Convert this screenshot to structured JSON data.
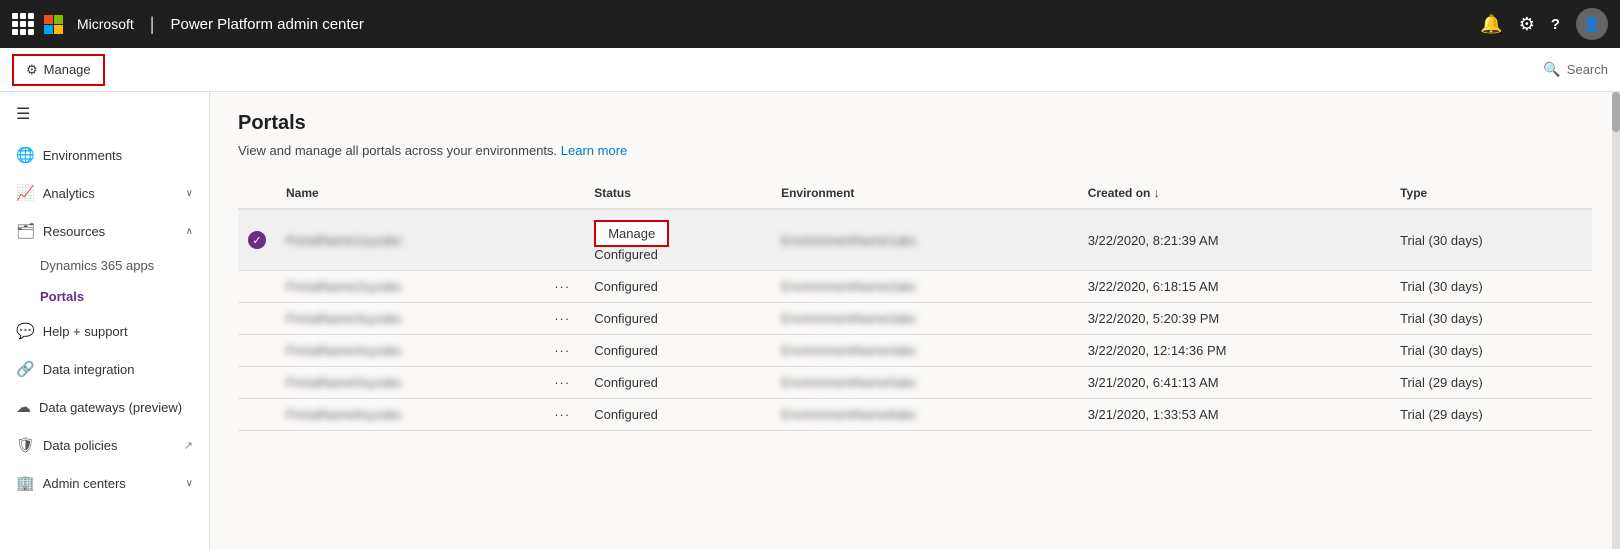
{
  "topNav": {
    "appName": "Power Platform admin center",
    "icons": {
      "bell": "🔔",
      "settings": "⚙",
      "help": "?",
      "waffle": "waffle"
    }
  },
  "secondaryNav": {
    "manageBtn": "Manage",
    "manageBtnIcon": "⚙",
    "searchPlaceholder": "Search"
  },
  "sidebar": {
    "hamburgerIcon": "☰",
    "items": [
      {
        "id": "environments",
        "label": "Environments",
        "icon": "🌐",
        "hasChevron": false,
        "active": false
      },
      {
        "id": "analytics",
        "label": "Analytics",
        "icon": "📈",
        "hasChevron": true,
        "active": false
      },
      {
        "id": "resources",
        "label": "Resources",
        "icon": "🗂",
        "hasChevron": true,
        "active": false,
        "expanded": true
      },
      {
        "id": "dynamics365apps",
        "label": "Dynamics 365 apps",
        "icon": "",
        "isSubItem": true,
        "active": false
      },
      {
        "id": "portals",
        "label": "Portals",
        "icon": "",
        "isSubItem": true,
        "active": true
      },
      {
        "id": "helpsupport",
        "label": "Help + support",
        "icon": "💬",
        "hasChevron": false,
        "active": false
      },
      {
        "id": "dataintegration",
        "label": "Data integration",
        "icon": "🔗",
        "hasChevron": false,
        "active": false
      },
      {
        "id": "datagateways",
        "label": "Data gateways (preview)",
        "icon": "☁",
        "hasChevron": false,
        "active": false
      },
      {
        "id": "datapolicies",
        "label": "Data policies",
        "icon": "🛡",
        "hasChevron": false,
        "active": false,
        "hasExternalLink": true
      },
      {
        "id": "admincenters",
        "label": "Admin centers",
        "icon": "🏢",
        "hasChevron": true,
        "active": false
      }
    ]
  },
  "main": {
    "pageTitle": "Portals",
    "subtitle": "View and manage all portals across your environments.",
    "learnMoreLink": "Learn more",
    "table": {
      "columns": [
        {
          "id": "check",
          "label": ""
        },
        {
          "id": "name",
          "label": "Name"
        },
        {
          "id": "dots",
          "label": ""
        },
        {
          "id": "status",
          "label": "Status"
        },
        {
          "id": "environment",
          "label": "Environment"
        },
        {
          "id": "createdOn",
          "label": "Created on",
          "sorted": true,
          "sortDir": "↓"
        },
        {
          "id": "type",
          "label": "Type"
        }
      ],
      "rows": [
        {
          "id": 1,
          "name": "NameBlurred1",
          "selected": true,
          "showManagePopup": true,
          "status": "Configured",
          "environment": "EnvBlurred1",
          "createdOn": "3/22/2020, 8:21:39 AM",
          "type": "Trial (30 days)"
        },
        {
          "id": 2,
          "name": "NameBlurred2",
          "selected": false,
          "showManagePopup": false,
          "status": "Configured",
          "environment": "EnvBlurred2",
          "createdOn": "3/22/2020, 6:18:15 AM",
          "type": "Trial (30 days)"
        },
        {
          "id": 3,
          "name": "NameBlurred3",
          "selected": false,
          "showManagePopup": false,
          "status": "Configured",
          "environment": "EnvBlurred3",
          "createdOn": "3/22/2020, 5:20:39 PM",
          "type": "Trial (30 days)"
        },
        {
          "id": 4,
          "name": "NameBlurred4",
          "selected": false,
          "showManagePopup": false,
          "status": "Configured",
          "environment": "EnvBlurred4",
          "createdOn": "3/22/2020, 12:14:36 PM",
          "type": "Trial (30 days)"
        },
        {
          "id": 5,
          "name": "NameBlurred5",
          "selected": false,
          "showManagePopup": false,
          "status": "Configured",
          "environment": "EnvBlurred5",
          "createdOn": "3/21/2020, 6:41:13 AM",
          "type": "Trial (29 days)"
        },
        {
          "id": 6,
          "name": "NameBlurred6",
          "selected": false,
          "showManagePopup": false,
          "status": "Configured",
          "environment": "EnvBlurred6",
          "createdOn": "3/21/2020, 1:33:53 AM",
          "type": "Trial (29 days)"
        }
      ],
      "managePopupLabel": "Manage"
    }
  }
}
